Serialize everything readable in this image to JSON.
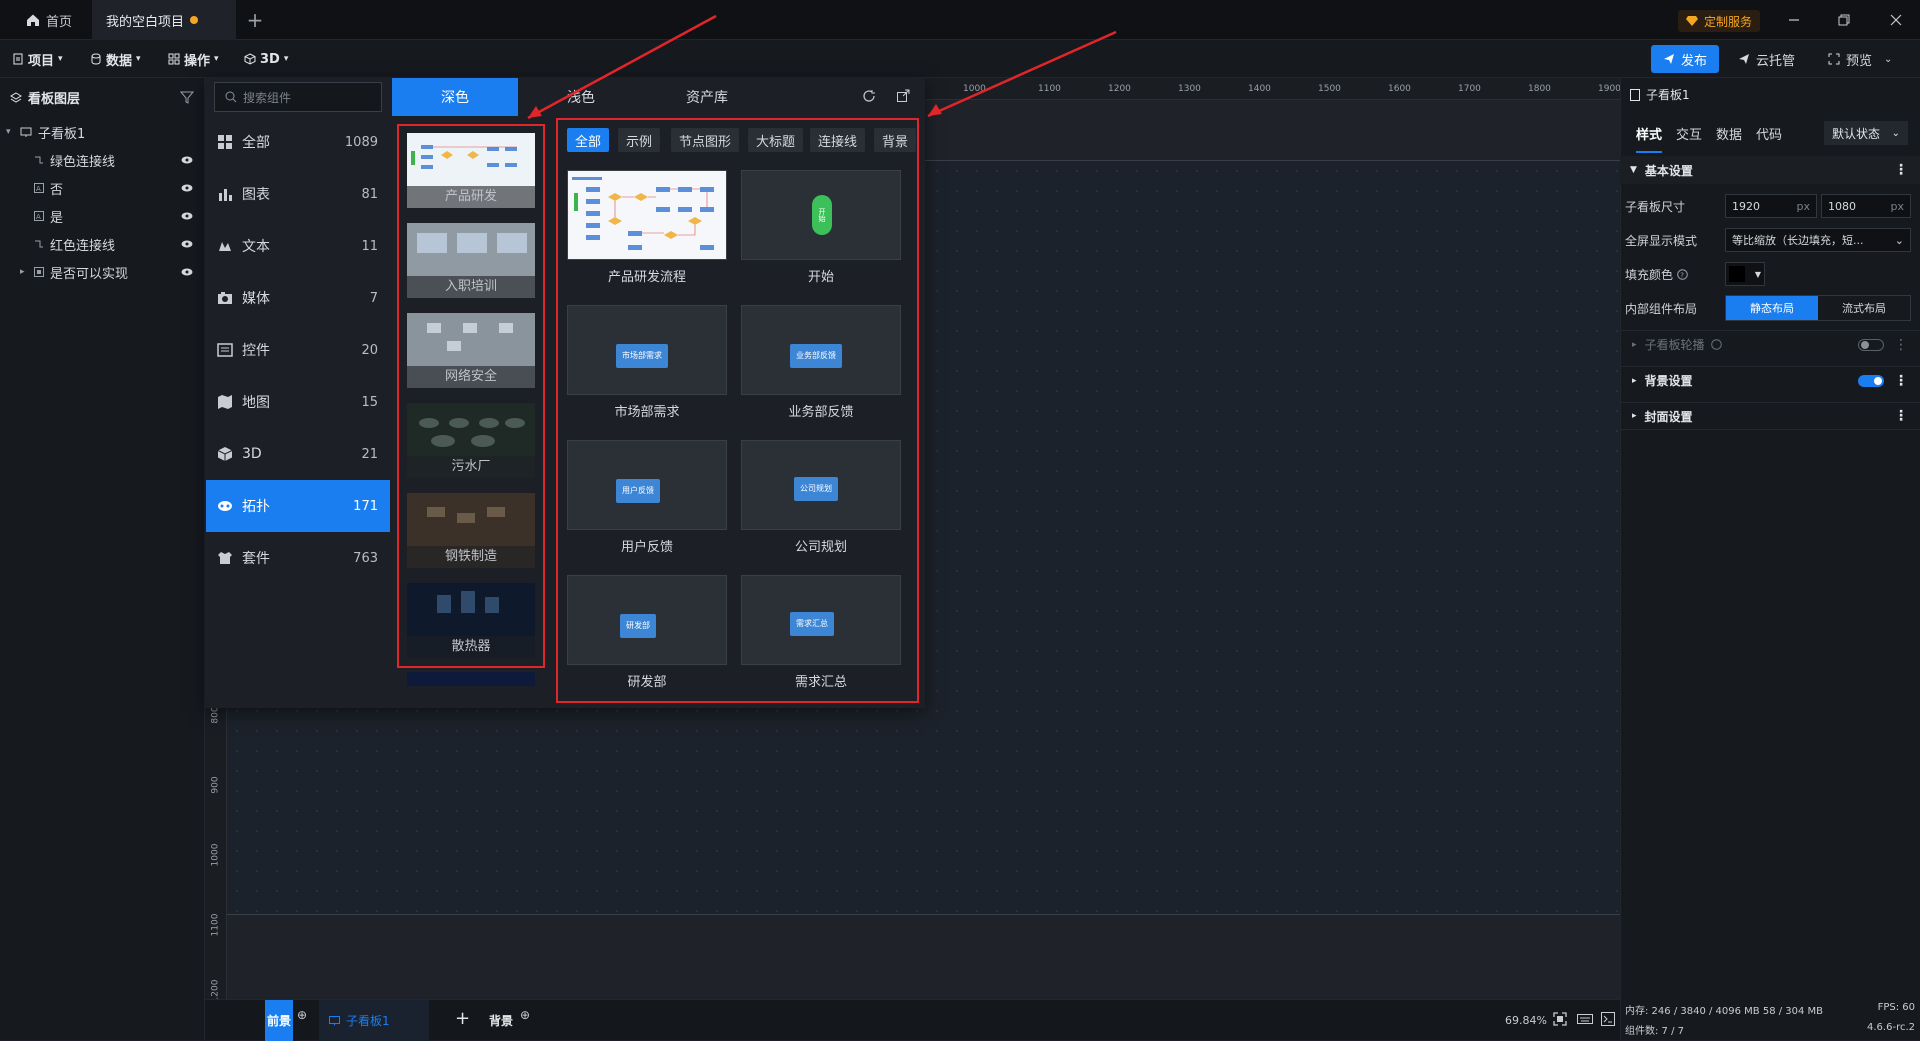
{
  "titlebar": {
    "home_tab": "首页",
    "project_tab": "我的空白项目",
    "custom_service": "定制服务"
  },
  "menubar": {
    "items": [
      "项目",
      "数据",
      "操作",
      "3D"
    ],
    "publish": "发布",
    "cloud": "云托管",
    "preview": "预览"
  },
  "layers": {
    "title": "看板图层",
    "items": [
      {
        "label": "子看板1"
      },
      {
        "label": "绿色连接线"
      },
      {
        "label": "否"
      },
      {
        "label": "是"
      },
      {
        "label": "红色连接线"
      },
      {
        "label": "是否可以实现"
      }
    ]
  },
  "component_panel": {
    "search_placeholder": "搜索组件",
    "theme_tabs": [
      "深色",
      "浅色",
      "资产库"
    ],
    "categories": [
      {
        "label": "全部",
        "count": "1089",
        "icon": "grid-icon"
      },
      {
        "label": "图表",
        "count": "81",
        "icon": "bar-chart-icon"
      },
      {
        "label": "文本",
        "count": "11",
        "icon": "text-icon"
      },
      {
        "label": "媒体",
        "count": "7",
        "icon": "media-icon"
      },
      {
        "label": "控件",
        "count": "20",
        "icon": "control-icon"
      },
      {
        "label": "地图",
        "count": "15",
        "icon": "map-icon"
      },
      {
        "label": "3D",
        "count": "21",
        "icon": "cube-icon"
      },
      {
        "label": "拓扑",
        "count": "171",
        "icon": "topology-icon"
      },
      {
        "label": "套件",
        "count": "763",
        "icon": "kit-icon"
      }
    ],
    "themes": [
      "产品研发",
      "入职培训",
      "网络安全",
      "污水厂",
      "钢铁制造",
      "散热器"
    ],
    "subtabs": [
      "全部",
      "示例",
      "节点图形",
      "大标题",
      "连接线",
      "背景"
    ],
    "cards": [
      {
        "label": "产品研发流程",
        "chip": ""
      },
      {
        "label": "开始",
        "chip": "开始"
      },
      {
        "label": "市场部需求",
        "chip": "市场部需求"
      },
      {
        "label": "业务部反馈",
        "chip": "业务部反馈"
      },
      {
        "label": "用户反馈",
        "chip": "用户反馈"
      },
      {
        "label": "公司规划",
        "chip": "公司规划"
      },
      {
        "label": "研发部",
        "chip": "研发部"
      },
      {
        "label": "需求汇总",
        "chip": "需求汇总"
      }
    ]
  },
  "ruler": {
    "x_ticks": [
      "1000",
      "1100",
      "1200",
      "1300",
      "1400",
      "1500",
      "1600",
      "1700",
      "1800",
      "1900"
    ],
    "y_ticks": [
      "800",
      "900",
      "1000",
      "1100",
      "1200"
    ]
  },
  "props": {
    "title": "子看板1",
    "tabs": [
      "样式",
      "交互",
      "数据",
      "代码"
    ],
    "state_select": "默认状态",
    "section_basic": "基本设置",
    "size_label": "子看板尺寸",
    "width": "1920",
    "height": "1080",
    "unit": "px",
    "fullscreen_label": "全屏显示模式",
    "fullscreen_value": "等比缩放（长边填充，短...",
    "fill_label": "填充颜色",
    "layout_label": "内部组件布局",
    "layout_static": "静态布局",
    "layout_flow": "流式布局",
    "carousel": "子看板轮播",
    "bg_settings": "背景设置",
    "cover_settings": "封面设置"
  },
  "statusbar": {
    "tab_front": "前景",
    "tab_board": "子看板1",
    "tab_back": "背景",
    "zoom": "69.84%",
    "memory": "内存: 246 / 3840 / 4096 MB  58 / 304 MB",
    "fps": "FPS: 60",
    "component_count": "组件数: 7 / 7",
    "version": "4.6.6-rc.2"
  },
  "colors": {
    "accent": "#1a7ef0",
    "highlight_box": "#e0262b",
    "background": "#1b1e24"
  }
}
